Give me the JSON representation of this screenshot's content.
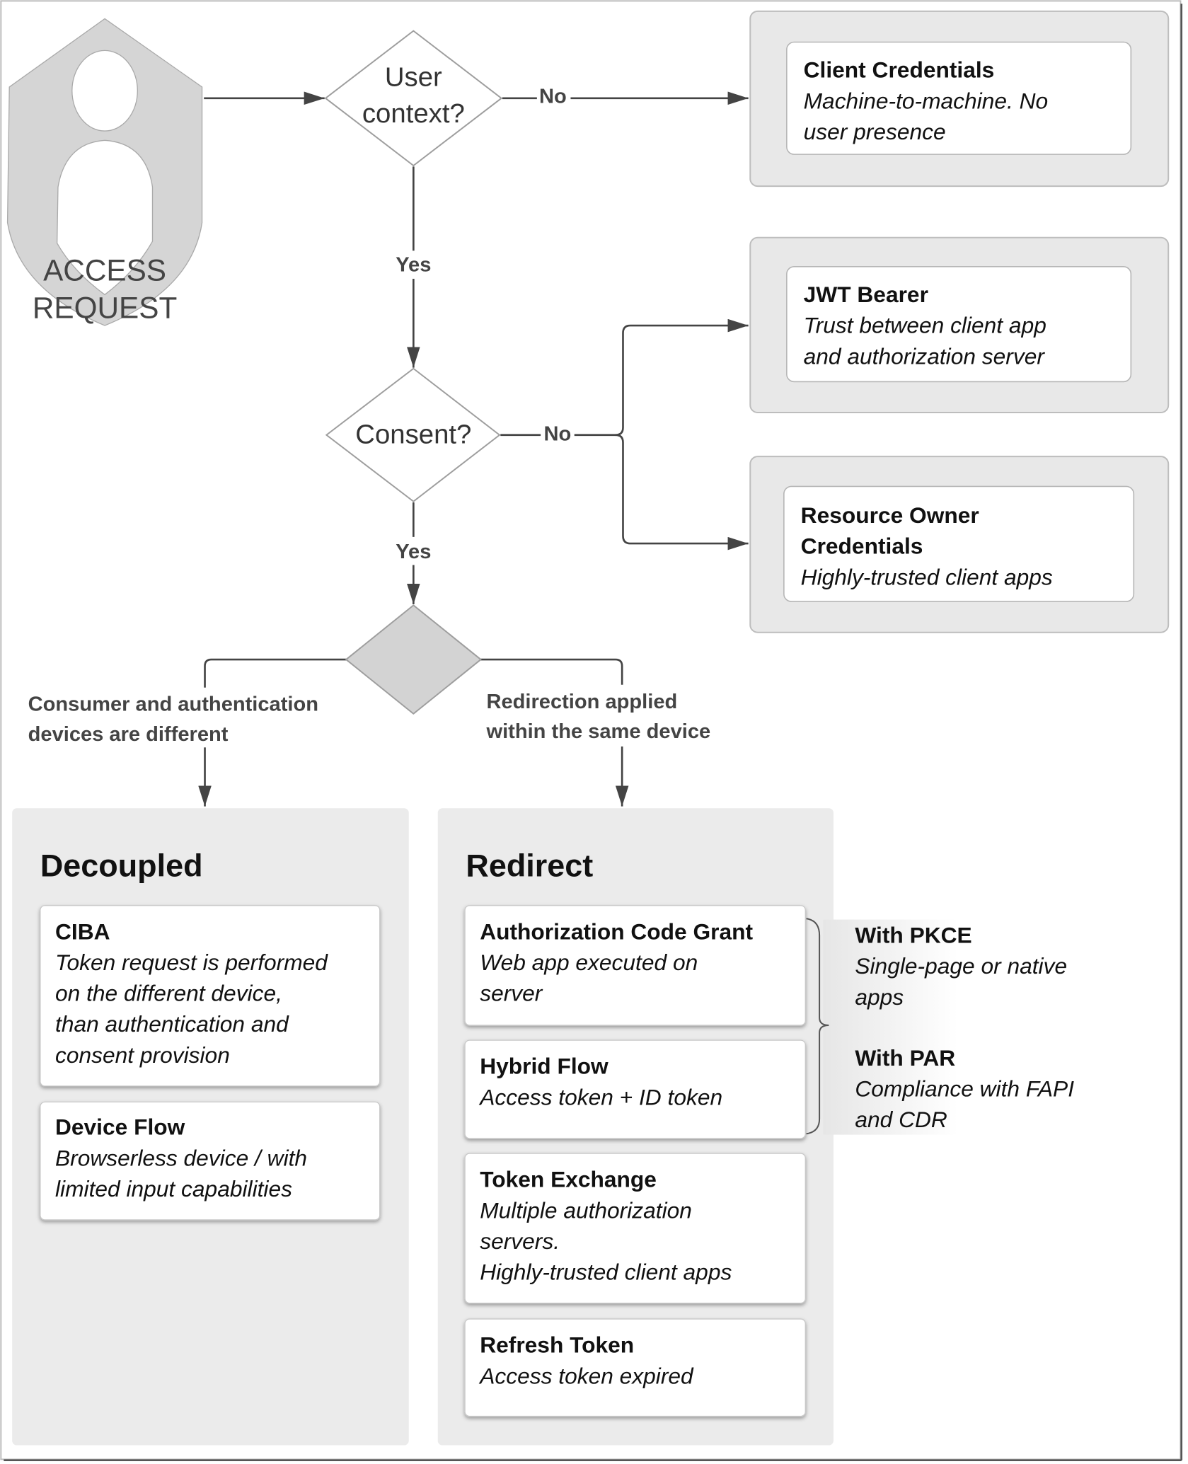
{
  "start": {
    "icon": "shield-user-icon",
    "label_lines": [
      "ACCESS",
      "REQUEST"
    ]
  },
  "decisions": {
    "user_context": {
      "lines": [
        "User",
        "context?"
      ],
      "yes": "Yes",
      "no": "No"
    },
    "consent": {
      "label": "Consent?",
      "yes": "Yes",
      "no": "No"
    },
    "device": {
      "left_label": [
        "Consumer and authentication",
        "devices are different"
      ],
      "right_label": [
        "Redirection applied",
        "within the same device"
      ]
    }
  },
  "no_user_context": {
    "title": "Client Credentials",
    "desc": [
      "Machine-to-machine. No",
      "user presence"
    ]
  },
  "no_consent": [
    {
      "title": [
        "JWT Bearer"
      ],
      "desc": [
        "Trust between client app",
        "and authorization server"
      ]
    },
    {
      "title": [
        "Resource Owner",
        "Credentials"
      ],
      "desc": [
        "Highly-trusted client apps"
      ]
    }
  ],
  "decoupled": {
    "heading": "Decoupled",
    "cards": [
      {
        "title": "CIBA",
        "desc": [
          "Token request is performed",
          "on the different device,",
          "than authentication and",
          "consent provision"
        ]
      },
      {
        "title": "Device Flow",
        "desc": [
          "Browserless device / with",
          "limited input capabilities"
        ]
      }
    ]
  },
  "redirect": {
    "heading": "Redirect",
    "cards": [
      {
        "title": "Authorization Code Grant",
        "desc": [
          "Web app executed on",
          "server"
        ]
      },
      {
        "title": "Hybrid Flow",
        "desc": [
          "Access token + ID token"
        ]
      },
      {
        "title": "Token Exchange",
        "desc": [
          "Multiple authorization",
          "servers.",
          "Highly-trusted client apps"
        ]
      },
      {
        "title": "Refresh Token",
        "desc": [
          "Access token expired"
        ]
      }
    ],
    "extensions": [
      {
        "title": "With PKCE",
        "desc": [
          "Single-page or native",
          "apps"
        ]
      },
      {
        "title": "With PAR",
        "desc": [
          "Compliance with FAPI",
          "and CDR"
        ]
      }
    ]
  }
}
